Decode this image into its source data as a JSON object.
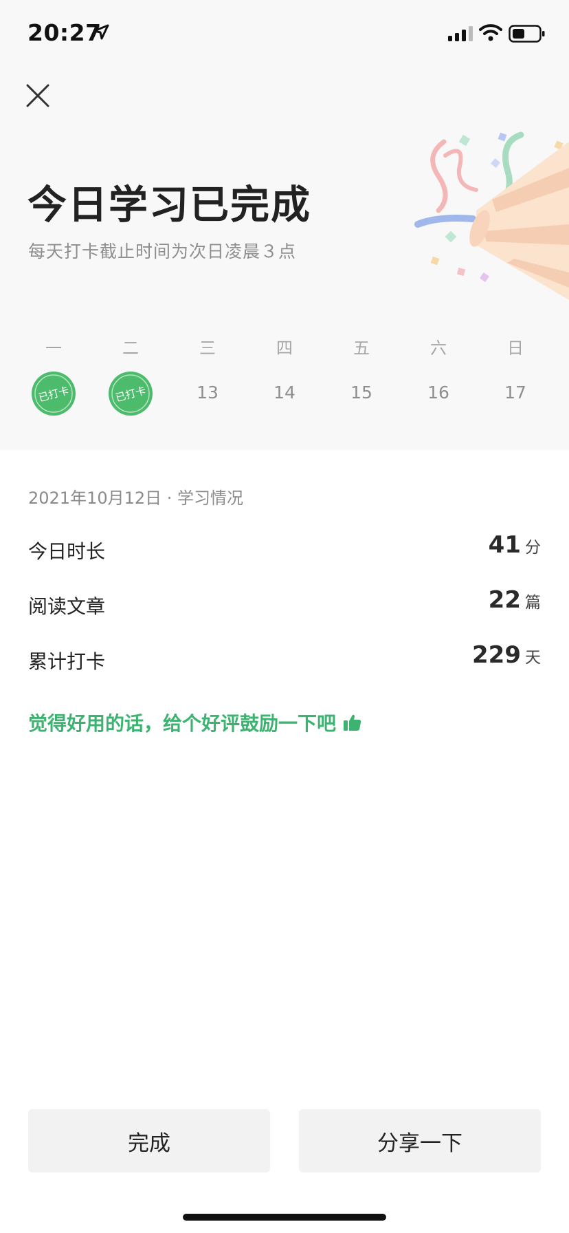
{
  "status_bar": {
    "time": "20:27"
  },
  "header": {
    "title": "今日学习已完成",
    "subtitle": "每天打卡截止时间为次日凌晨３点"
  },
  "week": {
    "days": [
      {
        "weekday": "一",
        "day": "",
        "checked": true
      },
      {
        "weekday": "二",
        "day": "",
        "checked": true
      },
      {
        "weekday": "三",
        "day": "13",
        "checked": false
      },
      {
        "weekday": "四",
        "day": "14",
        "checked": false
      },
      {
        "weekday": "五",
        "day": "15",
        "checked": false
      },
      {
        "weekday": "六",
        "day": "16",
        "checked": false
      },
      {
        "weekday": "日",
        "day": "17",
        "checked": false
      }
    ],
    "checked_label": "已打卡"
  },
  "summary": {
    "date_heading": "2021年10月12日 · 学习情况",
    "stats": [
      {
        "label": "今日时长",
        "value": "41",
        "unit": "分"
      },
      {
        "label": "阅读文章",
        "value": "22",
        "unit": "篇"
      },
      {
        "label": "累计打卡",
        "value": "229",
        "unit": "天"
      }
    ],
    "review_prompt": "觉得好用的话，给个好评鼓励一下吧"
  },
  "actions": {
    "done_label": "完成",
    "share_label": "分享一下"
  },
  "colors": {
    "accent_green": "#3cb371",
    "badge_green": "#4cbb6c",
    "top_bg": "#f8f8f9",
    "button_bg": "#f2f2f2"
  }
}
